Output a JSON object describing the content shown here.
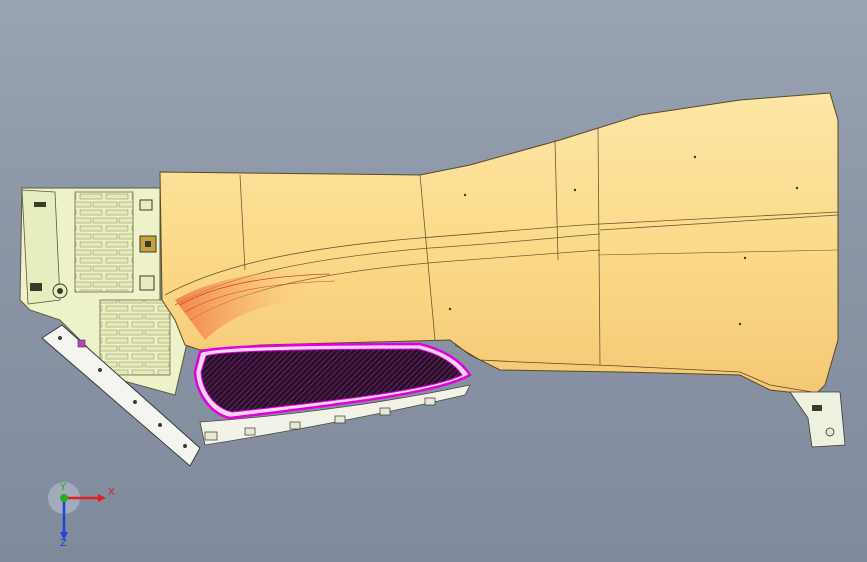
{
  "viewport": {
    "background_top": "#9aa3b3",
    "background_bottom": "#7f8a9c"
  },
  "model": {
    "body_color": "#fbd987",
    "body_highlight": "#fde6a6",
    "rib_color": "#eef2c8",
    "grille_color": "#2a0f2a",
    "grille_edge": "#e000e0",
    "bracket_color": "#f2f2f0"
  },
  "triad": {
    "x_label": "X",
    "y_label": "Y",
    "z_label": "Z",
    "x_color": "#e02020",
    "y_color": "#20b020",
    "z_color": "#2040e0"
  }
}
